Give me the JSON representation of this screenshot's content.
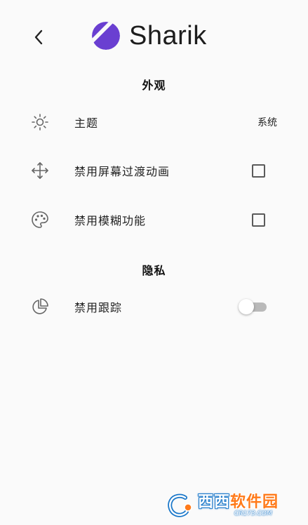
{
  "header": {
    "back_icon": "chevron-left-icon",
    "app_name": "Sharik",
    "logo_color": "#6a3fd1"
  },
  "sections": [
    {
      "title": "外观",
      "items": [
        {
          "label": "主题",
          "icon": "brightness-icon",
          "control": "value",
          "value": "系统"
        },
        {
          "label": "禁用屏幕过渡动画",
          "icon": "move-arrows-icon",
          "control": "checkbox",
          "checked": false
        },
        {
          "label": "禁用模糊功能",
          "icon": "palette-icon",
          "control": "checkbox",
          "checked": false
        }
      ]
    },
    {
      "title": "隐私",
      "items": [
        {
          "label": "禁用跟踪",
          "icon": "pie-chart-icon",
          "control": "switch",
          "on": false
        }
      ]
    }
  ],
  "watermark": {
    "text_main": "西西",
    "text_accent": "软件园",
    "text_sub": "CR173.COM"
  }
}
